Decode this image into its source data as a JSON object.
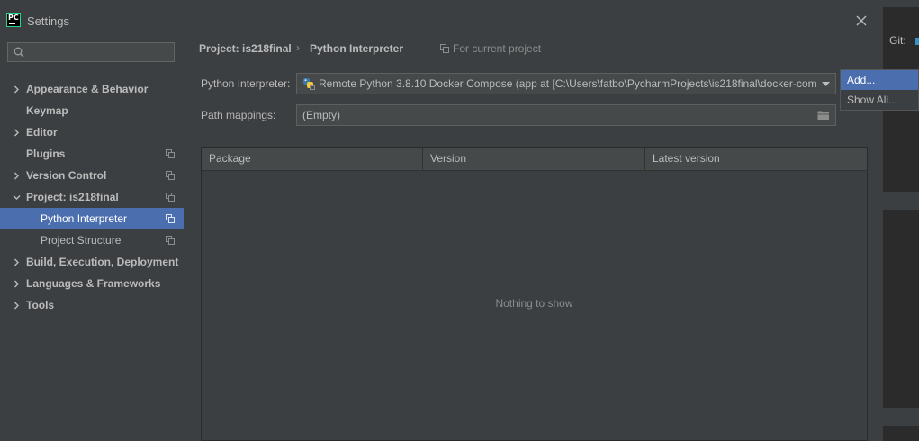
{
  "window": {
    "title": "Settings",
    "app_logo_text": "PC"
  },
  "ide_background": {
    "git_label": "Git:"
  },
  "sidebar": {
    "search_placeholder": "",
    "items": [
      {
        "label": "Appearance & Behavior",
        "expandable": true,
        "expanded": false,
        "project_scoped": false
      },
      {
        "label": "Keymap",
        "expandable": false,
        "project_scoped": false
      },
      {
        "label": "Editor",
        "expandable": true,
        "expanded": false,
        "project_scoped": false
      },
      {
        "label": "Plugins",
        "expandable": false,
        "project_scoped": true
      },
      {
        "label": "Version Control",
        "expandable": true,
        "expanded": false,
        "project_scoped": true
      },
      {
        "label": "Project: is218final",
        "expandable": true,
        "expanded": true,
        "project_scoped": true
      },
      {
        "label": "Python Interpreter",
        "child": true,
        "selected": true,
        "project_scoped": true
      },
      {
        "label": "Project Structure",
        "child": true,
        "project_scoped": true
      },
      {
        "label": "Build, Execution, Deployment",
        "expandable": true,
        "expanded": false,
        "project_scoped": false
      },
      {
        "label": "Languages & Frameworks",
        "expandable": true,
        "expanded": false,
        "project_scoped": false
      },
      {
        "label": "Tools",
        "expandable": true,
        "expanded": false,
        "project_scoped": false
      }
    ]
  },
  "main": {
    "breadcrumb": [
      "Project: is218final",
      "Python Interpreter"
    ],
    "breadcrumb_separator": "›",
    "scope_note": "For current project",
    "interpreter_label": "Python Interpreter:",
    "interpreter_value": "Remote Python 3.8.10 Docker Compose (app at [C:\\Users\\fatbo\\PycharmProjects\\is218final\\docker-com",
    "path_mappings_label": "Path mappings:",
    "path_mappings_value": "(Empty)",
    "table": {
      "columns": [
        "Package",
        "Version",
        "Latest version"
      ],
      "rows": [],
      "empty_text": "Nothing to show"
    }
  },
  "popup_menu": {
    "items": [
      {
        "label": "Add...",
        "active": true
      },
      {
        "label": "Show All...",
        "active": false
      }
    ]
  },
  "colors": {
    "selection": "#4b6eaf",
    "panel": "#3c3f41",
    "background": "#2b2b2b",
    "text": "#bbbbbb"
  }
}
